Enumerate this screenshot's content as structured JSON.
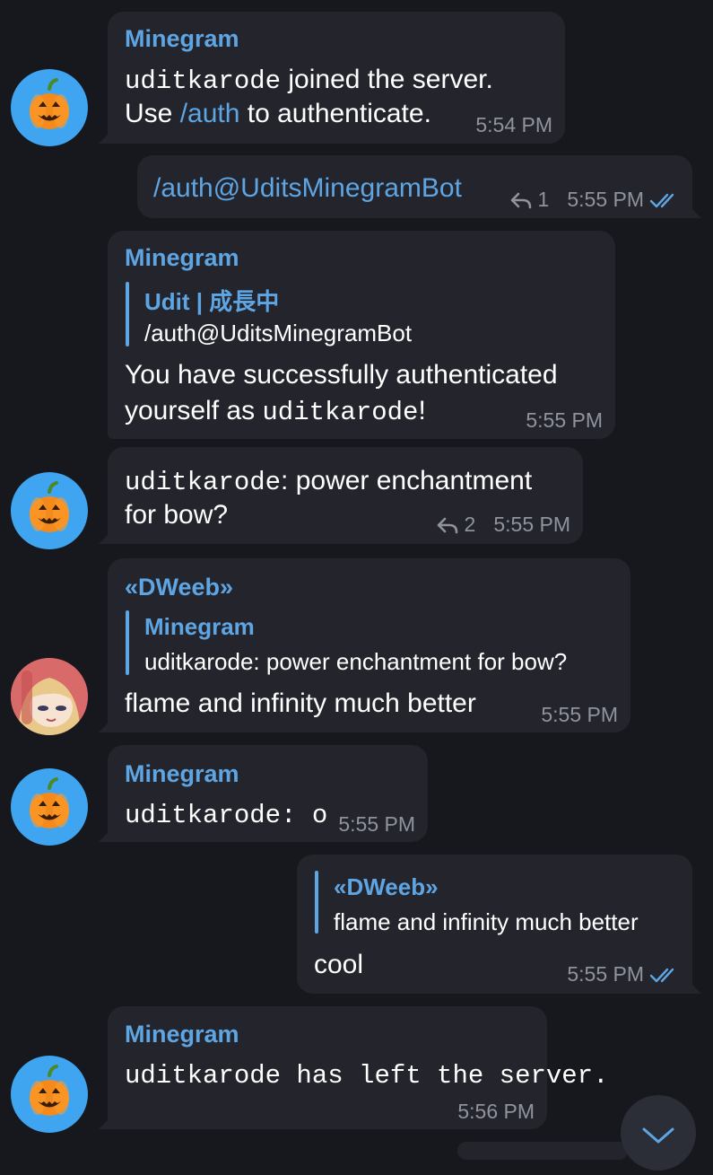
{
  "colors": {
    "background": "#17181e",
    "bubble": "#24252c",
    "accent": "#5ea5e3",
    "meta": "#8e939e",
    "pumpkin_avatar_bg": "#3fa5f0"
  },
  "messages": [
    {
      "sender": "Minegram",
      "line1_user": "uditkarode",
      "line1_rest": " joined the server.",
      "line2_pre": "Use ",
      "line2_cmd": "/auth",
      "line2_post": " to authenticate.",
      "time": "5:54 PM",
      "avatar_icon": "pumpkin-icon"
    },
    {
      "text": "/auth@UditsMinegramBot",
      "reply_count": "1",
      "time": "5:55 PM",
      "status_icon": "double-check-icon"
    },
    {
      "sender": "Minegram",
      "reply_to_name": "Udit | 成長中",
      "reply_to_text": "/auth@UditsMinegramBot",
      "line1": "You have successfully authenticated",
      "line2_pre": "yourself as ",
      "line2_user": "uditkarode",
      "line2_post": "!",
      "time": "5:55 PM"
    },
    {
      "line1_user": "uditkarode",
      "line1_rest": ": power enchantment",
      "line2": "for bow?",
      "reply_count": "2",
      "time": "5:55 PM",
      "avatar_icon": "pumpkin-icon"
    },
    {
      "sender": "«DWeeb»",
      "reply_to_name": "Minegram",
      "reply_to_text": "uditkarode: power enchantment for bow?",
      "text": "flame and infinity much better",
      "time": "5:55 PM",
      "avatar_icon": "anime-avatar-icon"
    },
    {
      "sender": "Minegram",
      "user": "uditkarode",
      "rest": ": o",
      "time": "5:55 PM",
      "avatar_icon": "pumpkin-icon"
    },
    {
      "reply_to_name": "«DWeeb»",
      "reply_to_text": "flame and infinity much better",
      "text": "cool",
      "time": "5:55 PM",
      "status_icon": "double-check-icon"
    },
    {
      "sender": "Minegram",
      "user": "uditkarode",
      "rest": " has left the server.",
      "time": "5:56 PM",
      "avatar_icon": "pumpkin-icon"
    }
  ],
  "scroll_button_icon": "chevron-down-icon"
}
